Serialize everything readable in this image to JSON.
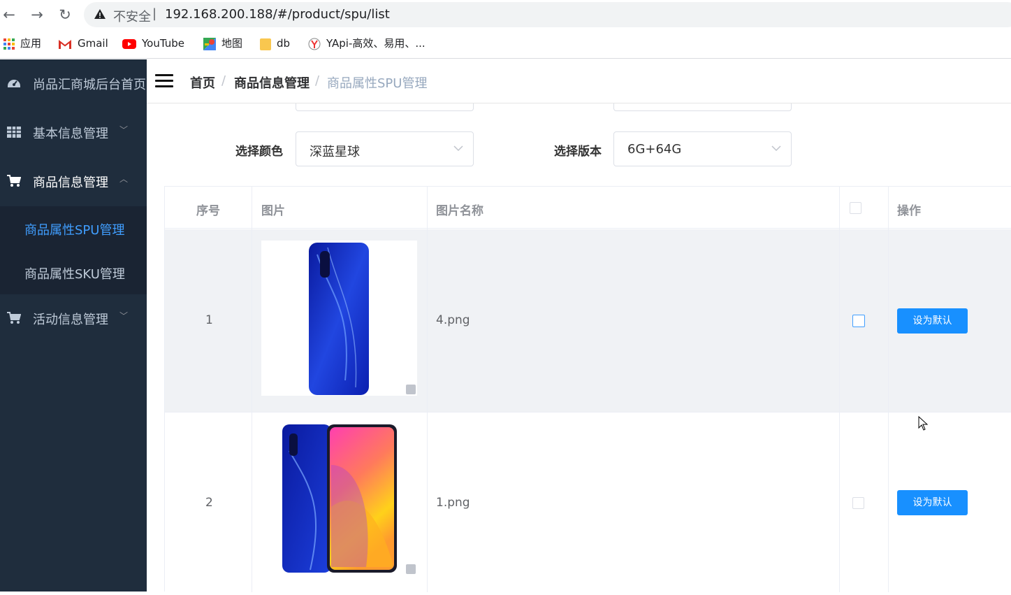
{
  "browser": {
    "back": "←",
    "forward": "→",
    "reload": "↻",
    "insecure_label": "不安全",
    "separator": "|",
    "url": "192.168.200.188/#/product/spu/list"
  },
  "bookmarks": [
    {
      "label": "应用",
      "icon": "apps-grid-icon"
    },
    {
      "label": "Gmail",
      "icon": "gmail-icon"
    },
    {
      "label": "YouTube",
      "icon": "youtube-icon"
    },
    {
      "label": "地图",
      "icon": "maps-icon"
    },
    {
      "label": "db",
      "icon": "folder-icon"
    },
    {
      "label": "YApi-高效、易用、...",
      "icon": "yapi-icon"
    }
  ],
  "sidebar": {
    "items": [
      {
        "label": "尚品汇商城后台首页",
        "icon": "dashboard-icon"
      },
      {
        "label": "基本信息管理",
        "icon": "table-icon",
        "chevron": "﹀"
      },
      {
        "label": "商品信息管理",
        "icon": "cart-icon",
        "chevron": "︿"
      },
      {
        "label": "活动信息管理",
        "icon": "cart-icon",
        "chevron": "﹀"
      }
    ],
    "sub_items": [
      {
        "label": "商品属性SPU管理",
        "active": true
      },
      {
        "label": "商品属性SKU管理",
        "active": false
      }
    ]
  },
  "breadcrumb": {
    "home": "首页",
    "section": "商品信息管理",
    "current": "商品属性SPU管理",
    "separator": "/"
  },
  "form": {
    "color_label": "选择颜色",
    "color_value": "深蓝星球",
    "version_label": "选择版本",
    "version_value": "6G+64G"
  },
  "table": {
    "headers": [
      "序号",
      "图片",
      "图片名称",
      "操作"
    ],
    "rows": [
      {
        "index": "1",
        "image_name": "4.png",
        "action": "设为默认",
        "checked": false
      },
      {
        "index": "2",
        "image_name": "1.png",
        "action": "设为默认",
        "checked": false
      }
    ]
  },
  "colors": {
    "sidebar_bg": "#1f2d3d",
    "sidebar_active": "#409eff",
    "button": "#1890ff"
  }
}
